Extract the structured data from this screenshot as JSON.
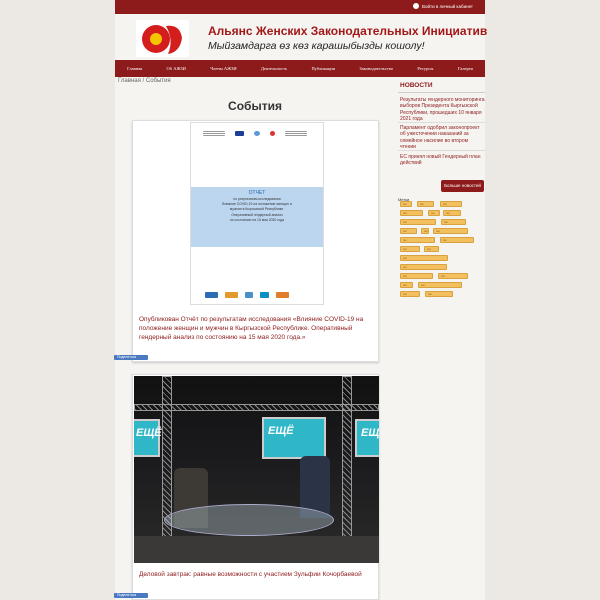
{
  "header": {
    "login_label": "Войти в личный кабинет",
    "site_title": "Альянс Женских Законодательных Инициатив",
    "site_subtitle": "Мыйзамдарга өз көз карашыбызды кошолу!"
  },
  "nav": [
    "Главная",
    "Об АЖЗИ",
    "Члены АЖЗИ",
    "Деятельность",
    "Публикации",
    "Законодательство",
    "Ресурсы",
    "Галерея"
  ],
  "breadcrumb": {
    "home": "Главная",
    "separator": " / ",
    "current": "События"
  },
  "main": {
    "title": "События",
    "posts": [
      {
        "doc": {
          "title": "ОТЧЕТ",
          "lines": [
            "по результатам исследования",
            "Влияние COVID-19 на положение женщин и",
            "мужчин в Кыргызской Республике.",
            "Оперативный гендерный анализ",
            "по состоянию на 15 мая 2020 года"
          ]
        },
        "text": "Опубликован Отчёт по результатам исследования «Влияние COVID-19 на положение женщин и мужчин в Кыргызской Республике. Оперативный гендерный анализ по состоянию на 15 мая 2020 года.»",
        "share_label": "Поделиться"
      },
      {
        "photo_screen_text": "ЕЩЁ",
        "text": "Деловой завтрак: равные возможности с участием Зульфии Кочорбаевой",
        "share_label": "Поделиться"
      }
    ]
  },
  "sidebar": {
    "news_title": "НОВОСТИ",
    "news": [
      "Результаты гендерного мониторинга выборов Президента Кыргызской Республики, прошедших 10 января 2021 года",
      "Парламент одобрил законопроект об ужесточении наказаний за семейное насилие во втором чтении",
      "ЕС принял новый Гендерный план действий"
    ],
    "more_label": "Больше новостей",
    "tags_title": "Метки",
    "tags": [
      "тег",
      "тег",
      "тег",
      "тег",
      "тег",
      "тег",
      "тег",
      "тег",
      "тег",
      "тег",
      "тег",
      "тег",
      "тег",
      "тег",
      "тег",
      "тег",
      "тег",
      "тег",
      "тег",
      "тег",
      "тег",
      "тег",
      "тег"
    ]
  },
  "colors": {
    "brand": "#8d1b1b",
    "accent_link": "#8d1b1b",
    "tag": "#f3c060",
    "share": "#4a79c2"
  }
}
